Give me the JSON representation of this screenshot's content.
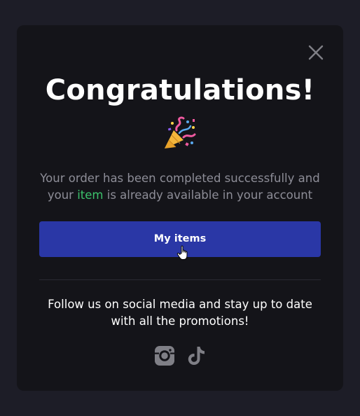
{
  "modal": {
    "title": "Congratulations!",
    "message_part1": "Your order has been completed successfully and your ",
    "message_highlight": "item",
    "message_part2": " is already available in your account",
    "primary_button_label": "My items",
    "follow_text": "Follow us on social media and stay up to date with all the promotions!"
  },
  "icons": {
    "close": "close-icon",
    "celebration": "party-popper-icon",
    "cursor": "hand-pointer-icon",
    "instagram": "instagram-icon",
    "tiktok": "tiktok-icon"
  },
  "colors": {
    "page_background": "#1d1d27",
    "modal_background": "#141419",
    "primary_button": "#2a37a6",
    "highlight": "#3bc26b",
    "muted_text": "#8d8d97",
    "icon_gray": "#7f7f86"
  }
}
